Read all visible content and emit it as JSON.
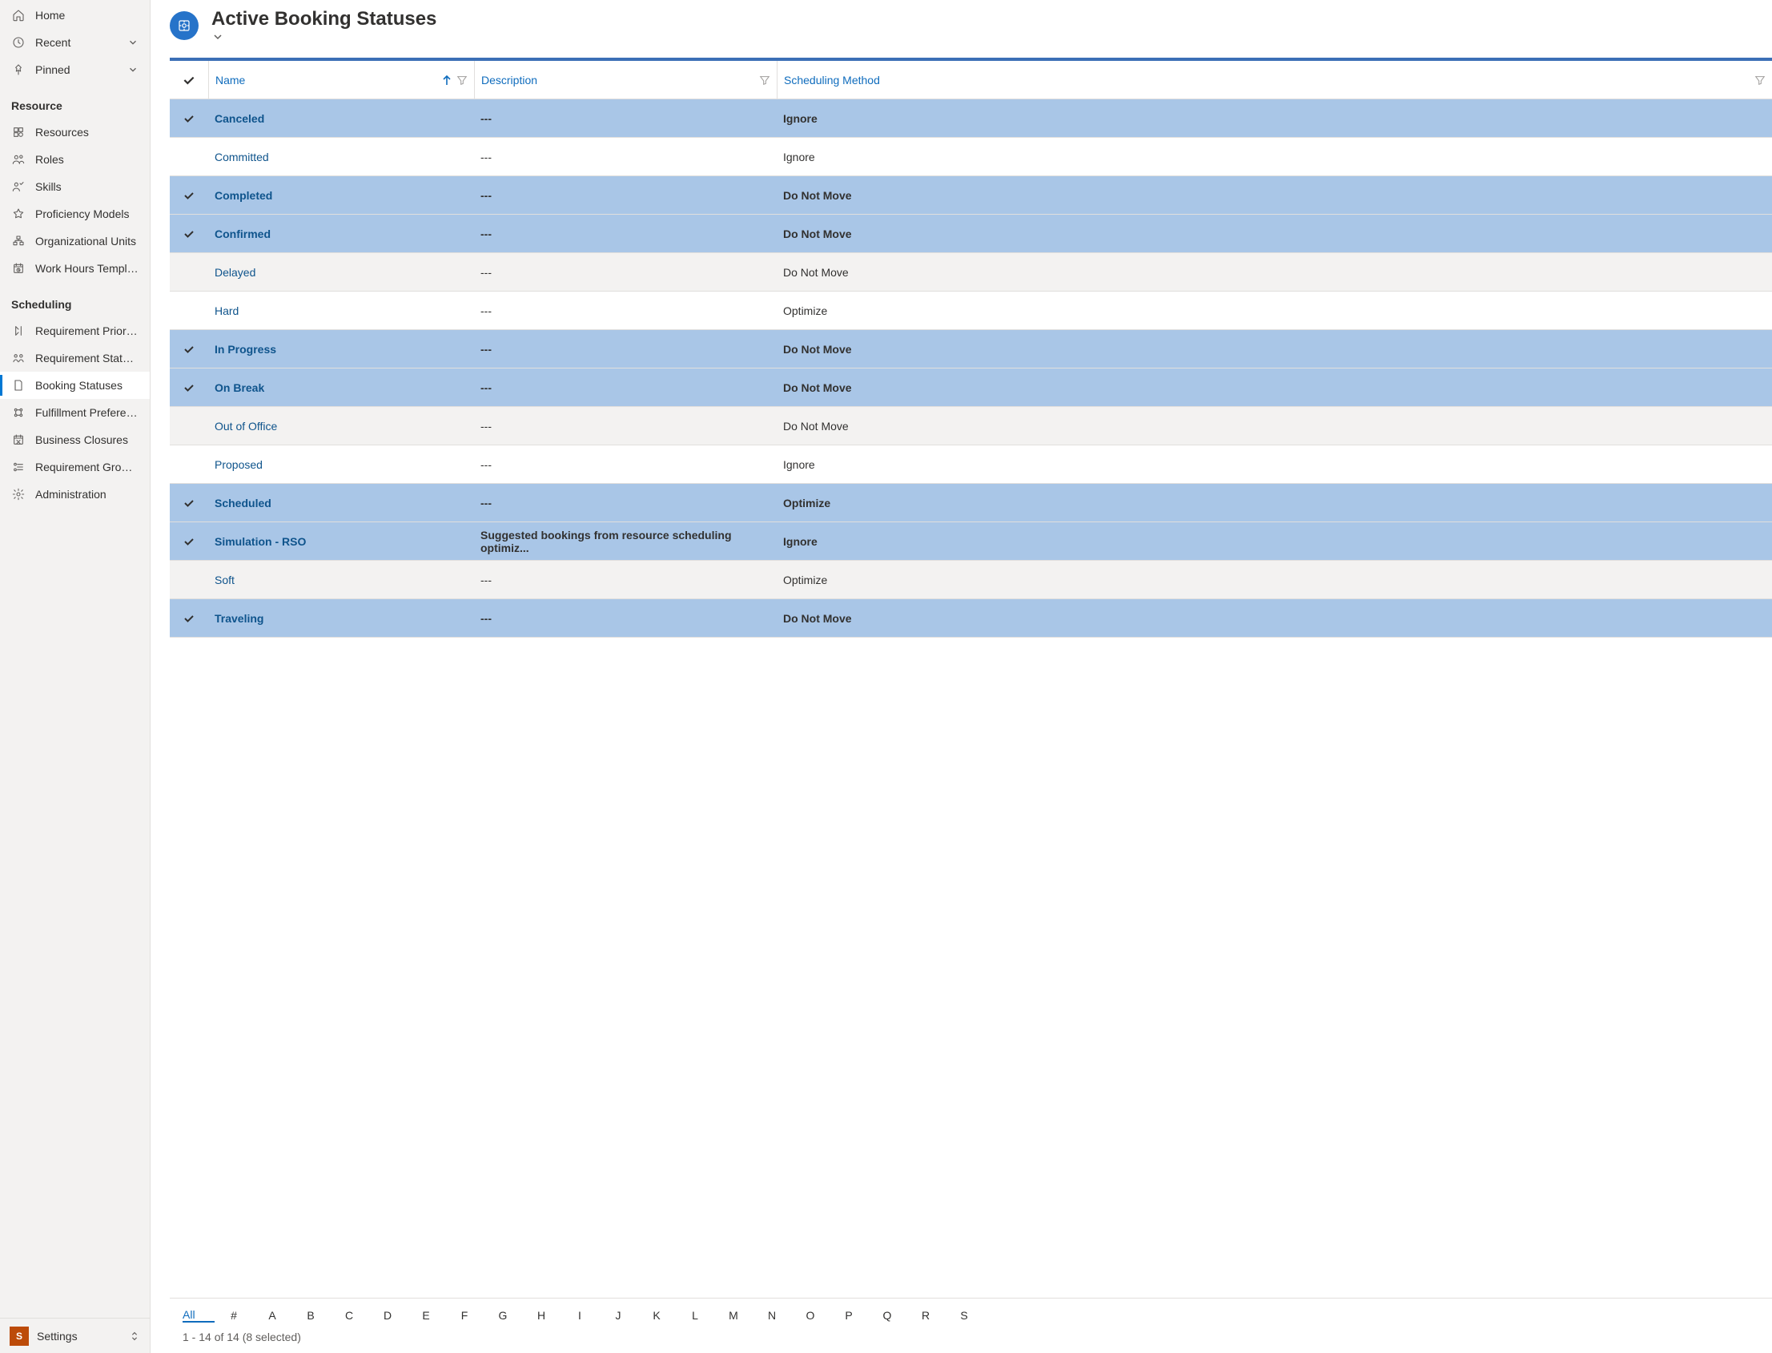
{
  "sidebar": {
    "top": [
      {
        "icon": "home",
        "label": "Home",
        "chev": false
      },
      {
        "icon": "clock",
        "label": "Recent",
        "chev": true
      },
      {
        "icon": "pin",
        "label": "Pinned",
        "chev": true
      }
    ],
    "groups": [
      {
        "title": "Resource",
        "items": [
          {
            "icon": "resources",
            "label": "Resources"
          },
          {
            "icon": "roles",
            "label": "Roles"
          },
          {
            "icon": "skills",
            "label": "Skills"
          },
          {
            "icon": "star",
            "label": "Proficiency Models"
          },
          {
            "icon": "org",
            "label": "Organizational Units"
          },
          {
            "icon": "workhours",
            "label": "Work Hours Templates"
          }
        ]
      },
      {
        "title": "Scheduling",
        "items": [
          {
            "icon": "priority",
            "label": "Requirement Priorities"
          },
          {
            "icon": "reqstatus",
            "label": "Requirement Statuses"
          },
          {
            "icon": "bookstatus",
            "label": "Booking Statuses",
            "active": true
          },
          {
            "icon": "fulfill",
            "label": "Fulfillment Preferences"
          },
          {
            "icon": "closure",
            "label": "Business Closures"
          },
          {
            "icon": "reqgroup",
            "label": "Requirement Group ..."
          },
          {
            "icon": "gear",
            "label": "Administration"
          }
        ]
      }
    ],
    "footer": {
      "badge": "S",
      "label": "Settings"
    }
  },
  "header": {
    "title": "Active Booking Statuses"
  },
  "grid": {
    "columns": {
      "name": "Name",
      "desc": "Description",
      "meth": "Scheduling Method"
    },
    "rows": [
      {
        "selected": true,
        "name": "Canceled",
        "desc": "---",
        "meth": "Ignore"
      },
      {
        "selected": false,
        "name": "Committed",
        "desc": "---",
        "meth": "Ignore"
      },
      {
        "selected": true,
        "name": "Completed",
        "desc": "---",
        "meth": "Do Not Move"
      },
      {
        "selected": true,
        "name": "Confirmed",
        "desc": "---",
        "meth": "Do Not Move"
      },
      {
        "selected": false,
        "alt": true,
        "name": "Delayed",
        "desc": "---",
        "meth": "Do Not Move"
      },
      {
        "selected": false,
        "name": "Hard",
        "desc": "---",
        "meth": "Optimize"
      },
      {
        "selected": true,
        "name": "In Progress",
        "desc": "---",
        "meth": "Do Not Move"
      },
      {
        "selected": true,
        "name": "On Break",
        "desc": "---",
        "meth": "Do Not Move"
      },
      {
        "selected": false,
        "alt": true,
        "name": "Out of Office",
        "desc": "---",
        "meth": "Do Not Move"
      },
      {
        "selected": false,
        "name": "Proposed",
        "desc": "---",
        "meth": "Ignore"
      },
      {
        "selected": true,
        "name": "Scheduled",
        "desc": "---",
        "meth": "Optimize"
      },
      {
        "selected": true,
        "name": "Simulation - RSO",
        "desc": "Suggested bookings from resource scheduling optimiz...",
        "meth": "Ignore"
      },
      {
        "selected": false,
        "alt": true,
        "name": "Soft",
        "desc": "---",
        "meth": "Optimize"
      },
      {
        "selected": true,
        "name": "Traveling",
        "desc": "---",
        "meth": "Do Not Move"
      }
    ],
    "letters": [
      "All",
      "#",
      "A",
      "B",
      "C",
      "D",
      "E",
      "F",
      "G",
      "H",
      "I",
      "J",
      "K",
      "L",
      "M",
      "N",
      "O",
      "P",
      "Q",
      "R",
      "S"
    ],
    "active_letter": "All",
    "status": "1 - 14 of 14 (8 selected)"
  }
}
